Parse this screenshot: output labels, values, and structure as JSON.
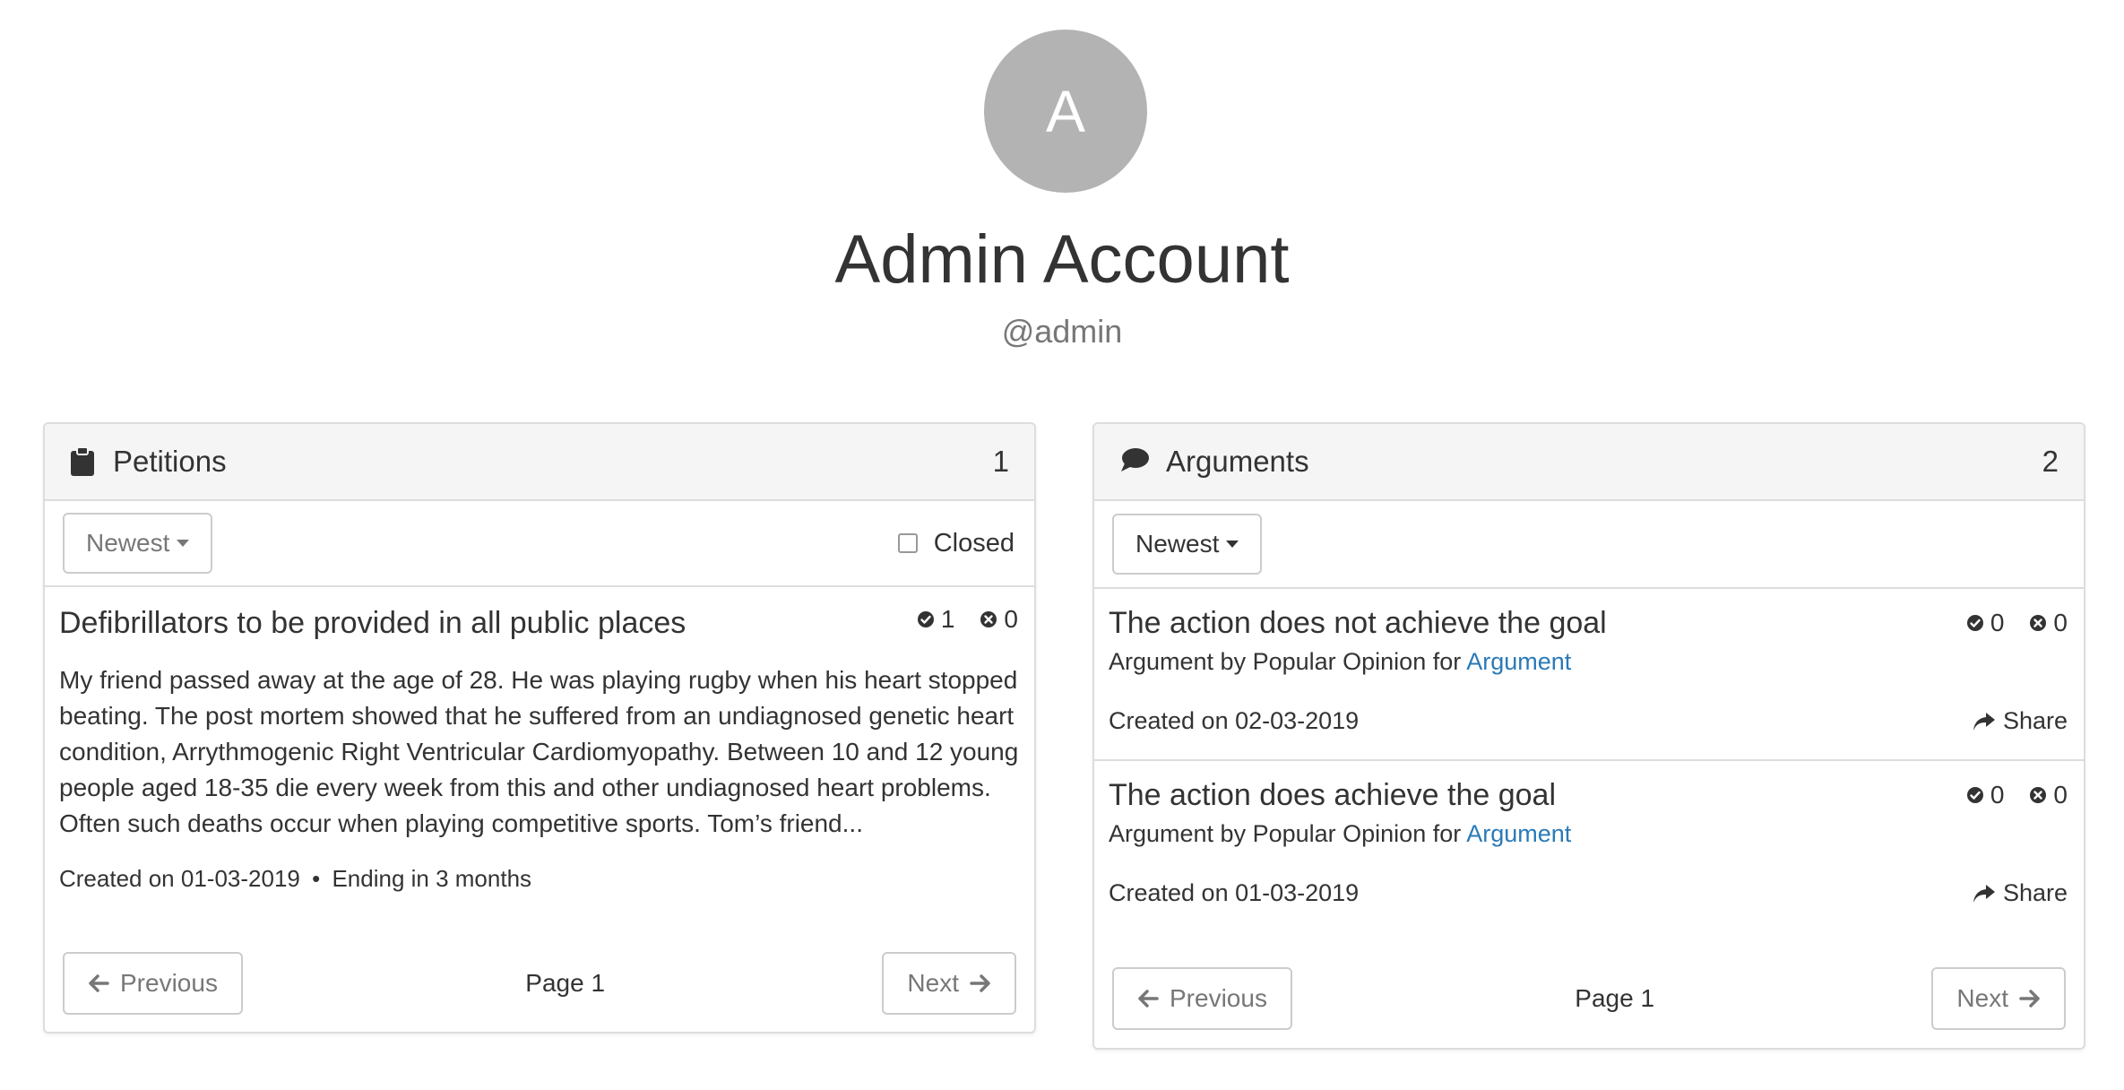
{
  "profile": {
    "avatar_initial": "A",
    "name": "Admin Account",
    "handle": "@admin"
  },
  "colors": {
    "avatar_bg": "#b3b3b3",
    "link": "#2a7ab8",
    "panel_heading_bg": "#f5f5f5",
    "border": "#dddddd"
  },
  "petitions": {
    "title": "Petitions",
    "count": "1",
    "sort_label": "Newest",
    "closed_label": "Closed",
    "items": [
      {
        "title": "Defibrillators to be provided in all public places",
        "upvotes": "1",
        "downvotes": "0",
        "body": "My friend passed away at the age of 28. He was playing rugby when his heart stopped beating. The post mortem showed that he suffered from an undiagnosed genetic heart condition, Arrythmogenic Right Ventricular Cardiomyopathy. Between 10 and 12 young people aged 18-35 die every week from this and other undiagnosed heart problems. Often such deaths occur when playing competitive sports. Tom’s friend...",
        "created": "Created on 01-03-2019",
        "separator": "•",
        "ending": "Ending in 3 months"
      }
    ],
    "pager": {
      "previous": "Previous",
      "page": "Page 1",
      "next": "Next"
    }
  },
  "arguments": {
    "title": "Arguments",
    "count": "2",
    "sort_label": "Newest",
    "items": [
      {
        "title": "The action does not achieve the goal",
        "upvotes": "0",
        "downvotes": "0",
        "byline": "Argument by Popular Opinion for",
        "link": "Argument",
        "created": "Created on 02-03-2019",
        "share": "Share"
      },
      {
        "title": "The action does achieve the goal",
        "upvotes": "0",
        "downvotes": "0",
        "byline": "Argument by Popular Opinion for",
        "link": "Argument",
        "created": "Created on 01-03-2019",
        "share": "Share"
      }
    ],
    "pager": {
      "previous": "Previous",
      "page": "Page 1",
      "next": "Next"
    }
  },
  "icons": {
    "petitions": "clipboard-icon",
    "arguments": "speech-bubble-icon",
    "upvote": "check-circle-icon",
    "downvote": "x-circle-icon",
    "share": "share-arrow-icon",
    "previous": "arrow-left-icon",
    "next": "arrow-right-icon",
    "sort": "caret-down-icon"
  }
}
